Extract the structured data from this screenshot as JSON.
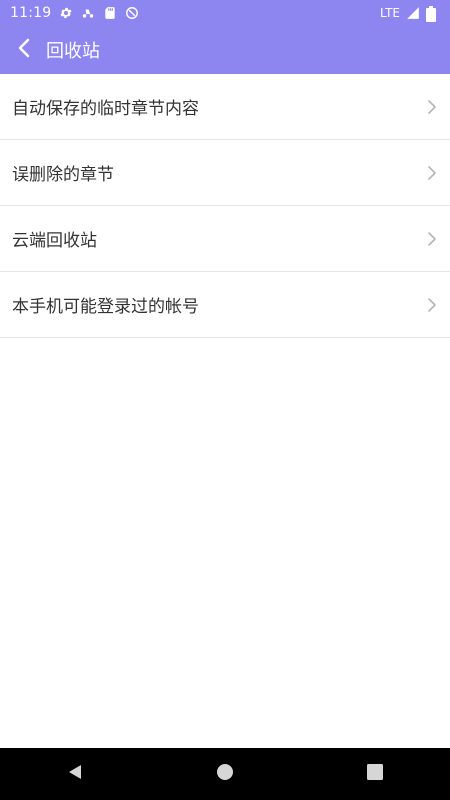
{
  "status_bar": {
    "time": "11:19",
    "network": "LTE",
    "icons": [
      "gear-icon",
      "scooter-icon",
      "sd-card-icon",
      "do-not-disturb-icon",
      "signal-icon",
      "battery-icon"
    ]
  },
  "app_bar": {
    "title": "回收站",
    "back_icon": "chevron-left-icon"
  },
  "list": {
    "items": [
      {
        "label": "自动保存的临时章节内容"
      },
      {
        "label": "误删除的章节"
      },
      {
        "label": "云端回收站"
      },
      {
        "label": "本手机可能登录过的帐号"
      }
    ]
  },
  "nav_bar": {
    "icons": [
      "back-triangle-icon",
      "home-circle-icon",
      "recents-square-icon"
    ]
  },
  "colors": {
    "primary": "#8d85f0",
    "divider": "#e6e6e6",
    "text": "#333333",
    "chevron": "#b5b5b5",
    "nav_bg": "#000000"
  }
}
